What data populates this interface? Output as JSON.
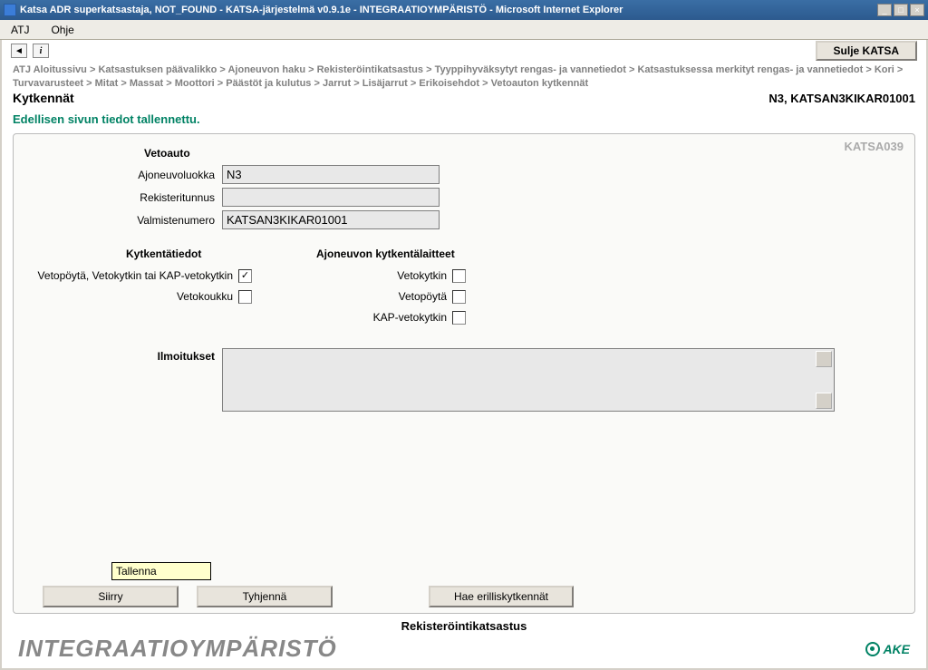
{
  "window": {
    "title": "Katsa ADR superkatsastaja, NOT_FOUND - KATSA-järjestelmä v0.9.1e - INTEGRAATIOYMPÄRISTÖ - Microsoft Internet Explorer"
  },
  "menubar": {
    "atj": "ATJ",
    "ohje": "Ohje"
  },
  "toolbar": {
    "back_glyph": "◄",
    "info_glyph": "i",
    "sulje_label": "Sulje KATSA"
  },
  "breadcrumb": {
    "items": [
      "ATJ Aloitussivu",
      "Katsastuksen päävalikko",
      "Ajoneuvon haku",
      "Rekisteröintikatsastus",
      "Tyyppihyväksytyt rengas- ja vannetiedot",
      "Katsastuksessa merkityt rengas- ja vannetiedot",
      "Kori",
      "Turvavarusteet",
      "Mitat",
      "Massat",
      "Moottori",
      "Päästöt ja kulutus",
      "Jarrut",
      "Lisäjarrut",
      "Erikoisehdot",
      "Vetoauton kytkennät"
    ]
  },
  "page": {
    "title": "Kytkennät",
    "right_info": "N3, KATSAN3KIKAR01001",
    "status": "Edellisen sivun tiedot tallennettu.",
    "panel_code": "KATSA039"
  },
  "vetoauto": {
    "heading": "Vetoauto",
    "ajoneuvoluokka_label": "Ajoneuvoluokka",
    "ajoneuvoluokka_value": "N3",
    "rekisteritunnus_label": "Rekisteritunnus",
    "rekisteritunnus_value": "",
    "valmistenumero_label": "Valmistenumero",
    "valmistenumero_value": "KATSAN3KIKAR01001"
  },
  "kytkenta": {
    "heading": "Kytkentätiedot",
    "vetopoyta_label": "Vetopöytä, Vetokytkin tai KAP-vetokytkin",
    "vetokoukku_label": "Vetokoukku"
  },
  "laitteet": {
    "heading": "Ajoneuvon kytkentälaitteet",
    "vetokytkin_label": "Vetokytkin",
    "vetopoyta_label": "Vetopöytä",
    "kap_label": "KAP-vetokytkin"
  },
  "ilmoitukset": {
    "label": "Ilmoitukset",
    "value": ""
  },
  "tooltip": {
    "tallenna": "Tallenna"
  },
  "buttons": {
    "siirry": "Siirry",
    "tyhjenna": "Tyhjennä",
    "hae": "Hae erilliskytkennät"
  },
  "footer": {
    "section_label": "Rekisteröintikatsastus",
    "brand": "INTEGRAATIOYMPÄRISTÖ",
    "logo": "AKE"
  }
}
